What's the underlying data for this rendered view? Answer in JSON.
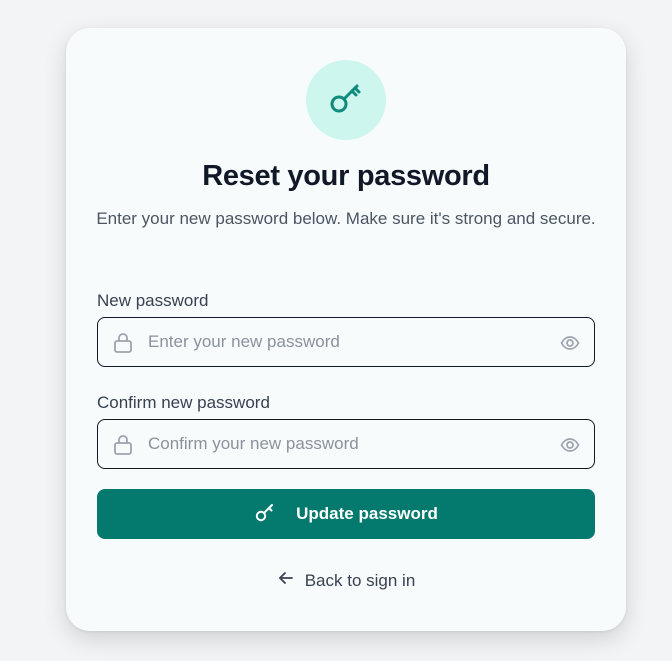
{
  "header": {
    "icon": "key-icon",
    "title": "Reset your password",
    "subtitle": "Enter your new password below. Make sure it's strong and secure."
  },
  "form": {
    "new_password": {
      "label": "New password",
      "placeholder": "Enter your new password",
      "value": "",
      "leading_icon": "lock-icon",
      "trailing_icon": "eye-icon"
    },
    "confirm_password": {
      "label": "Confirm new password",
      "placeholder": "Confirm your new password",
      "value": "",
      "leading_icon": "lock-icon",
      "trailing_icon": "eye-icon"
    },
    "submit": {
      "label": "Update password",
      "icon": "key-icon"
    }
  },
  "footer": {
    "back_label": "Back to sign in",
    "back_icon": "arrow-left-icon"
  },
  "colors": {
    "accent": "#047a6e",
    "badge_background": "#ccf6ee",
    "card_background": "#f7fbfc"
  }
}
